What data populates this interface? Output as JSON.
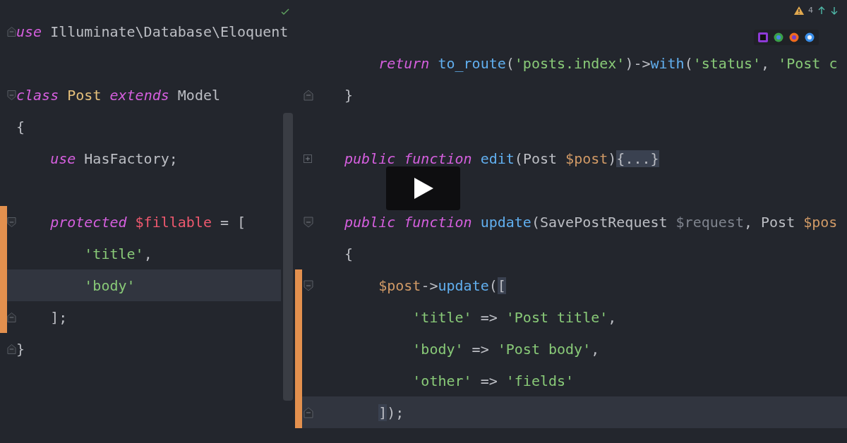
{
  "inspections": {
    "warnings": "4"
  },
  "left_editor": {
    "lines": [
      {
        "kind": "top",
        "modified": false,
        "current": false,
        "fold": {
          "kind": "close"
        },
        "tokens": [
          {
            "kind": "keyword",
            "text": "use"
          },
          {
            "kind": "plain",
            "text": " Illuminate\\Database\\Eloquent"
          }
        ]
      },
      {
        "kind": "blank",
        "modified": false,
        "current": false
      },
      {
        "kind": "top",
        "modified": false,
        "current": false,
        "fold": {
          "kind": "open"
        },
        "tokens": [
          {
            "kind": "keyword",
            "text": "class"
          },
          {
            "kind": "class",
            "text": " Post"
          },
          {
            "kind": "keyword",
            "text": " extends"
          },
          {
            "kind": "plain",
            "text": " Model"
          }
        ]
      },
      {
        "kind": "top",
        "modified": false,
        "current": false,
        "tokens": [
          {
            "kind": "plain",
            "text": "{"
          }
        ]
      },
      {
        "kind": "body",
        "modified": false,
        "current": false,
        "tokens": [
          {
            "kind": "keyword",
            "text": "use"
          },
          {
            "kind": "plain",
            "text": " HasFactory;"
          }
        ]
      },
      {
        "kind": "blank",
        "modified": false,
        "current": false
      },
      {
        "kind": "body",
        "modified": true,
        "current": false,
        "fold": {
          "kind": "open"
        },
        "tokens": [
          {
            "kind": "keyword",
            "text": "protected"
          },
          {
            "kind": "property",
            "text": " $fillable"
          },
          {
            "kind": "plain",
            "text": " = ["
          }
        ]
      },
      {
        "kind": "inner",
        "modified": true,
        "current": false,
        "tokens": [
          {
            "kind": "string",
            "text": "'title'"
          },
          {
            "kind": "plain",
            "text": ","
          }
        ]
      },
      {
        "kind": "inner",
        "modified": true,
        "current": true,
        "tokens": [
          {
            "kind": "string",
            "text": "'body'"
          }
        ]
      },
      {
        "kind": "body",
        "modified": true,
        "current": false,
        "fold": {
          "kind": "close"
        },
        "tokens": [
          {
            "kind": "plain",
            "text": "];"
          }
        ]
      },
      {
        "kind": "top",
        "modified": false,
        "current": false,
        "fold": {
          "kind": "close"
        },
        "tokens": [
          {
            "kind": "plain",
            "text": "}"
          }
        ]
      },
      {
        "kind": "blank",
        "modified": false,
        "current": false
      },
      {
        "kind": "blank",
        "modified": false,
        "current": false
      }
    ]
  },
  "right_editor": {
    "lines": [
      {
        "kind": "blank",
        "modified": false,
        "current": false
      },
      {
        "kind": "body",
        "modified": false,
        "current": false,
        "tokens": [
          {
            "kind": "keyword",
            "text": "return"
          },
          {
            "kind": "function",
            "text": " to_route"
          },
          {
            "kind": "plain",
            "text": "("
          },
          {
            "kind": "string",
            "text": "'posts.index'"
          },
          {
            "kind": "plain",
            "text": ")->"
          },
          {
            "kind": "function",
            "text": "with"
          },
          {
            "kind": "plain",
            "text": "("
          },
          {
            "kind": "string",
            "text": "'status'"
          },
          {
            "kind": "plain",
            "text": ","
          },
          {
            "kind": "string",
            "text": " 'Post c"
          }
        ]
      },
      {
        "kind": "top",
        "modified": false,
        "current": false,
        "fold": {
          "kind": "close"
        },
        "tokens": [
          {
            "kind": "plain",
            "text": "}"
          }
        ]
      },
      {
        "kind": "blank",
        "modified": false,
        "current": false
      },
      {
        "kind": "top",
        "modified": false,
        "current": false,
        "fold": {
          "kind": "collapsed"
        },
        "tokens": [
          {
            "kind": "keyword",
            "text": "public"
          },
          {
            "kind": "keyword",
            "text": " function"
          },
          {
            "kind": "function",
            "text": " edit"
          },
          {
            "kind": "plain",
            "text": "(Post"
          },
          {
            "kind": "variable",
            "text": " $post"
          },
          {
            "kind": "plain",
            "text": ")"
          },
          {
            "kind": "folded",
            "text": "{...}"
          }
        ]
      },
      {
        "kind": "blank",
        "modified": false,
        "current": false
      },
      {
        "kind": "top",
        "modified": false,
        "current": false,
        "fold": {
          "kind": "open"
        },
        "tokens": [
          {
            "kind": "keyword",
            "text": "public"
          },
          {
            "kind": "keyword",
            "text": " function"
          },
          {
            "kind": "function",
            "text": " update"
          },
          {
            "kind": "plain",
            "text": "(SavePostRequest"
          },
          {
            "kind": "param",
            "text": " $request"
          },
          {
            "kind": "plain",
            "text": ", Post"
          },
          {
            "kind": "variable",
            "text": " $pos"
          }
        ]
      },
      {
        "kind": "top",
        "modified": false,
        "current": false,
        "tokens": [
          {
            "kind": "plain",
            "text": "{"
          }
        ]
      },
      {
        "kind": "body",
        "modified": true,
        "current": false,
        "fold": {
          "kind": "open"
        },
        "tokens": [
          {
            "kind": "variable",
            "text": "$post"
          },
          {
            "kind": "plain",
            "text": "->"
          },
          {
            "kind": "function",
            "text": "update"
          },
          {
            "kind": "plain",
            "text": "("
          },
          {
            "kind": "folded",
            "text": "["
          }
        ]
      },
      {
        "kind": "inner",
        "modified": true,
        "current": false,
        "tokens": [
          {
            "kind": "string",
            "text": "'title'"
          },
          {
            "kind": "plain",
            "text": " =>"
          },
          {
            "kind": "string",
            "text": " 'Post title'"
          },
          {
            "kind": "plain",
            "text": ","
          }
        ]
      },
      {
        "kind": "inner",
        "modified": true,
        "current": false,
        "tokens": [
          {
            "kind": "string",
            "text": "'body'"
          },
          {
            "kind": "plain",
            "text": " =>"
          },
          {
            "kind": "string",
            "text": " 'Post body'"
          },
          {
            "kind": "plain",
            "text": ","
          }
        ]
      },
      {
        "kind": "inner",
        "modified": true,
        "current": false,
        "tokens": [
          {
            "kind": "string",
            "text": "'other'"
          },
          {
            "kind": "plain",
            "text": " =>"
          },
          {
            "kind": "string",
            "text": " 'fields'"
          }
        ]
      },
      {
        "kind": "body",
        "modified": true,
        "current": true,
        "fold": {
          "kind": "close"
        },
        "tokens": [
          {
            "kind": "folded",
            "text": "]"
          },
          {
            "kind": "plain",
            "text": ");"
          }
        ]
      }
    ]
  }
}
